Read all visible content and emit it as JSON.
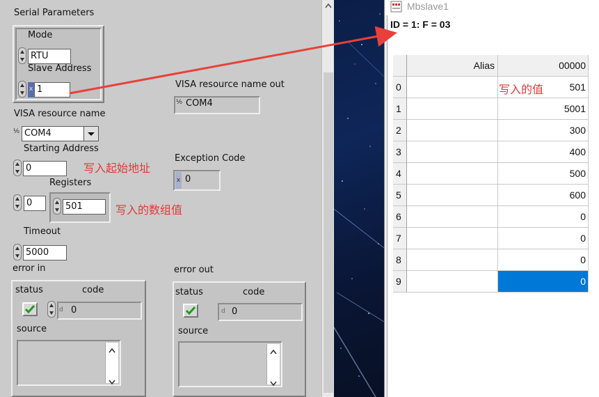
{
  "labview": {
    "serial_parameters_label": "Serial Parameters",
    "mode_label": "Mode",
    "mode_value": "RTU",
    "slave_address_label": "Slave Address",
    "slave_address_value": "1",
    "visa_out_label": "VISA resource name out",
    "visa_out_value": "COM4",
    "visa_in_label": "VISA resource name",
    "visa_in_value": "COM4",
    "starting_address_label": "Starting Address",
    "starting_address_value": "0",
    "exception_code_label": "Exception Code",
    "exception_code_value": "0",
    "registers_label": "Registers",
    "registers_index_value": "0",
    "registers_value": "501",
    "timeout_label": "Timeout",
    "timeout_value": "5000",
    "error_in": {
      "label": "error in",
      "status_label": "status",
      "code_label": "code",
      "code_value": "0",
      "source_label": "source"
    },
    "error_out": {
      "label": "error out",
      "status_label": "status",
      "code_label": "code",
      "code_value": "0",
      "source_label": "source"
    },
    "radix_x": "x",
    "radix_d": "d",
    "visa_glyph": "I/0"
  },
  "annotations": {
    "start_address": "写入起始地址",
    "array_value": "写入的数组值",
    "written_value": "写入的值"
  },
  "mbslave": {
    "title": "Mbslave1",
    "status": "ID = 1: F = 03",
    "columns": [
      "Alias",
      "00000"
    ],
    "rows": [
      {
        "index": "0",
        "alias": "",
        "value": "501"
      },
      {
        "index": "1",
        "alias": "",
        "value": "5001"
      },
      {
        "index": "2",
        "alias": "",
        "value": "300"
      },
      {
        "index": "3",
        "alias": "",
        "value": "400"
      },
      {
        "index": "4",
        "alias": "",
        "value": "500"
      },
      {
        "index": "5",
        "alias": "",
        "value": "600"
      },
      {
        "index": "6",
        "alias": "",
        "value": "0"
      },
      {
        "index": "7",
        "alias": "",
        "value": "0"
      },
      {
        "index": "8",
        "alias": "",
        "value": "0"
      },
      {
        "index": "9",
        "alias": "",
        "value": "0"
      }
    ],
    "selected_row": "9"
  },
  "colors": {
    "annotation_red": "#e03a3a",
    "selection_blue": "#0078d7",
    "arrow_red": "#e8403a"
  }
}
